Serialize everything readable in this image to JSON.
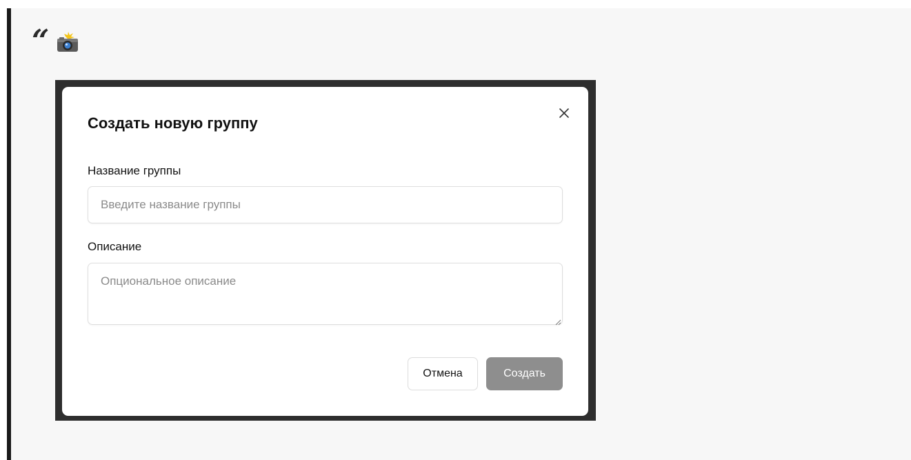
{
  "header": {
    "quote_glyph": "“",
    "camera_icon": "camera-with-flash-icon"
  },
  "dialog": {
    "title": "Создать новую группу",
    "close_icon": "close-icon",
    "name_field": {
      "label": "Название группы",
      "value": "",
      "placeholder": "Введите название группы"
    },
    "description_field": {
      "label": "Описание",
      "value": "",
      "placeholder": "Опциональное описание"
    },
    "buttons": {
      "cancel_label": "Отмена",
      "create_label": "Создать"
    }
  },
  "colors": {
    "page_background": "#f7f7f7",
    "backdrop": "#2e2e2e",
    "dialog_background": "#ffffff",
    "create_button_disabled": "#8e8e8e"
  }
}
